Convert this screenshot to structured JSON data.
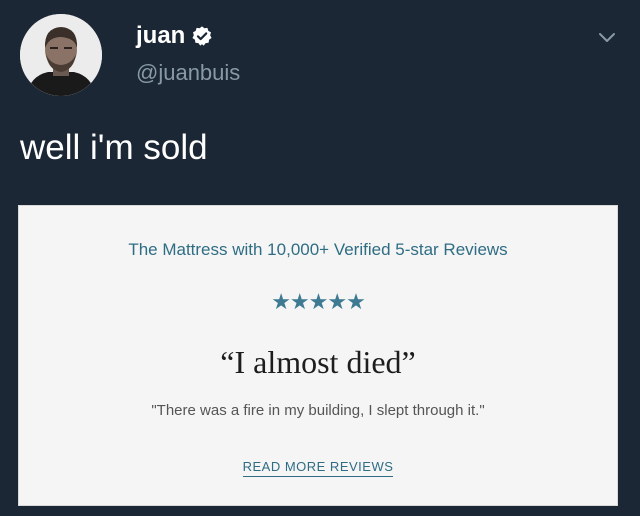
{
  "tweet": {
    "author_name": "juan",
    "handle": "@juanbuis",
    "text": "well i'm sold",
    "icons": {
      "avatar": "profile-photo",
      "verified": "verified-badge-icon",
      "menu": "chevron-down-icon"
    }
  },
  "card": {
    "headline": "The Mattress with 10,000+ Verified 5-star Reviews",
    "rating": {
      "stars_shown": 5,
      "stars_max": 5,
      "glyphs": "★★★★★"
    },
    "quote": "“I almost died”",
    "review_text": "\"There was a fire in my building, I slept through it.\"",
    "cta_label": "READ MORE REVIEWS"
  },
  "colors": {
    "background": "#1c2735",
    "accent": "#2f6d84",
    "card_background": "#f5f5f5"
  }
}
